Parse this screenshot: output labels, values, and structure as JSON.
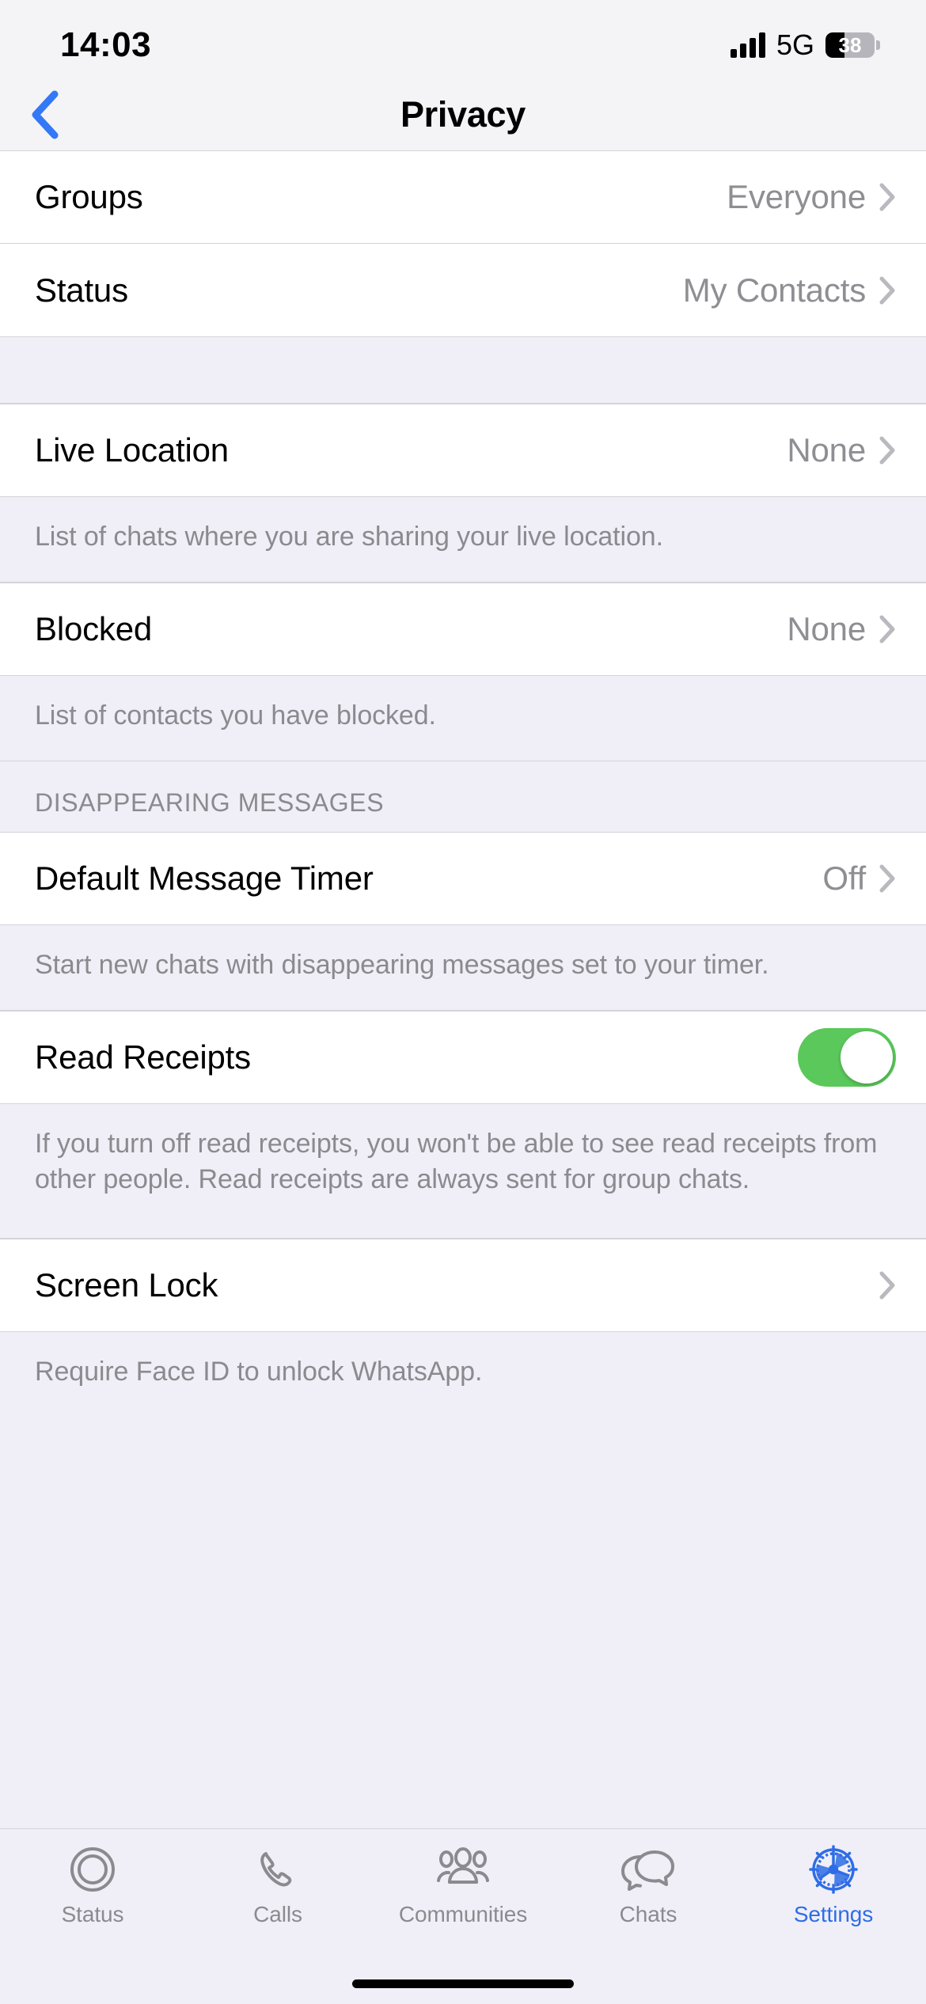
{
  "status_bar": {
    "time": "14:03",
    "network": "5G",
    "battery_percent": "38"
  },
  "nav": {
    "title": "Privacy",
    "back_label": "Back"
  },
  "sections": [
    {
      "rows": [
        {
          "label": "Groups",
          "value": "Everyone"
        },
        {
          "label": "Status",
          "value": "My Contacts"
        }
      ]
    },
    {
      "rows": [
        {
          "label": "Live Location",
          "value": "None"
        }
      ],
      "footer": "List of chats where you are sharing your live location."
    },
    {
      "rows": [
        {
          "label": "Blocked",
          "value": "None"
        }
      ],
      "footer": "List of contacts you have blocked."
    },
    {
      "header": "DISAPPEARING MESSAGES",
      "rows": [
        {
          "label": "Default Message Timer",
          "value": "Off"
        }
      ],
      "footer": "Start new chats with disappearing messages set to your timer."
    },
    {
      "rows": [
        {
          "label": "Read Receipts",
          "toggle": "on"
        }
      ],
      "footer": "If you turn off read receipts, you won't be able to see read receipts from other people. Read receipts are always sent for group chats."
    },
    {
      "rows": [
        {
          "label": "Screen Lock",
          "value": ""
        }
      ],
      "footer": "Require Face ID to unlock WhatsApp."
    }
  ],
  "tabbar": {
    "active_index": 4,
    "accent_color": "#2e6de6",
    "items": [
      {
        "label": "Status",
        "icon": "status-rings-icon"
      },
      {
        "label": "Calls",
        "icon": "phone-icon"
      },
      {
        "label": "Communities",
        "icon": "communities-icon"
      },
      {
        "label": "Chats",
        "icon": "chat-bubbles-icon"
      },
      {
        "label": "Settings",
        "icon": "gear-icon"
      }
    ]
  },
  "colors": {
    "toggle_on": "#5ac85a",
    "accent": "#2e6de6",
    "row_bg": "#ffffff",
    "page_bg": "#f0eff7"
  }
}
